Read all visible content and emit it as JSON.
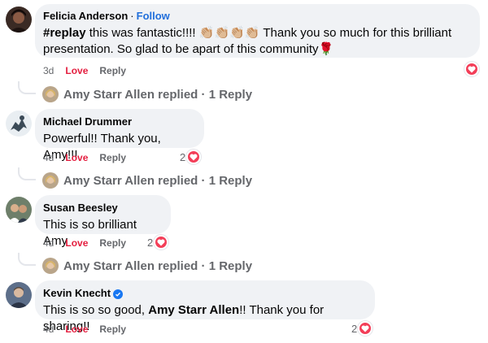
{
  "comments": [
    {
      "author": "Felicia Anderson",
      "follow_label": "Follow",
      "hashtag": "#replay",
      "text_before": " this was fantastic!!!! ",
      "emoji": "👏🏼👏🏼👏🏼👏🏼",
      "text_after": " Thank you so much for this brilliant presentation. So glad to be apart of this community",
      "trailing_emoji": "🌹",
      "time": "3d",
      "love_label": "Love",
      "reply_label": "Reply",
      "reaction_count": ""
    },
    {
      "author": "Michael Drummer",
      "text": "Powerful!! Thank you, Amy!!!",
      "time": "4d",
      "love_label": "Love",
      "reply_label": "Reply",
      "reaction_count": "2"
    },
    {
      "author": "Susan Beesley",
      "text": "This is so brilliant Amy",
      "time": "4d",
      "love_label": "Love",
      "reply_label": "Reply",
      "reaction_count": "2"
    },
    {
      "author": "Kevin Knecht",
      "text_before": "This is so so good, ",
      "mention": "Amy Starr Allen",
      "text_after": "!! Thank you for sharing!!",
      "time": "4d",
      "love_label": "Love",
      "reply_label": "Reply",
      "reaction_count": "2"
    }
  ],
  "replies_summary": {
    "name": "Amy Starr Allen",
    "action": " replied",
    "separator": " · ",
    "count_label": "1 Reply"
  },
  "colors": {
    "love": "#e41e3f",
    "follow": "#216fdb",
    "heart": "#f33e58",
    "bubble": "#f0f2f5"
  }
}
